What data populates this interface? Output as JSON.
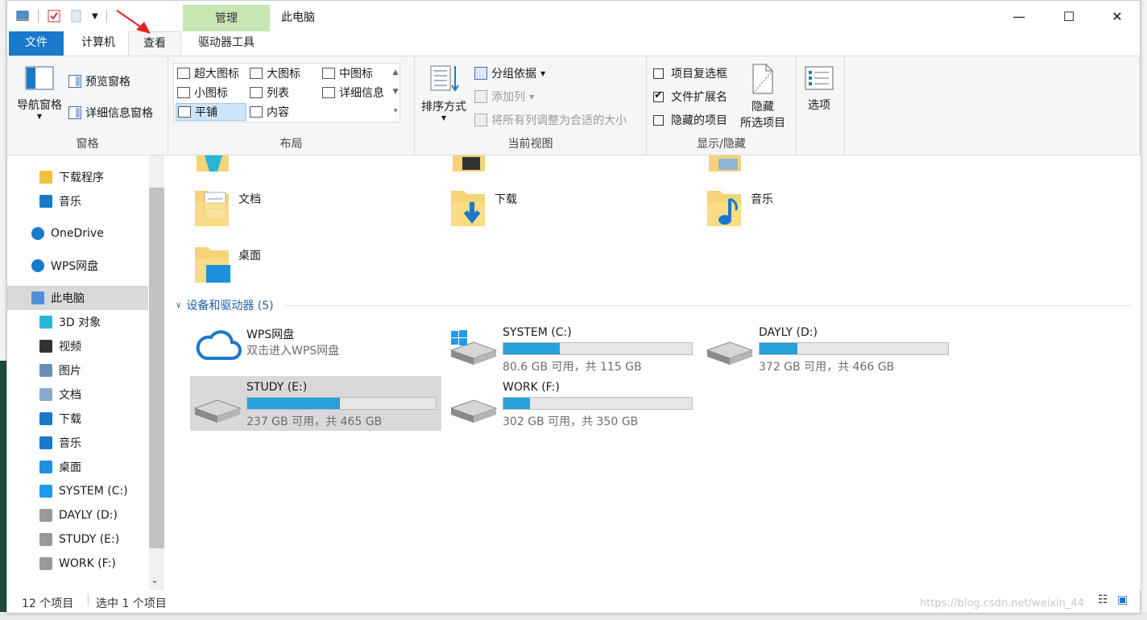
{
  "window": {
    "title": "此电脑",
    "context_tab": "管理"
  },
  "tabs": {
    "file": "文件",
    "computer": "计算机",
    "view": "查看",
    "drive_tools": "驱动器工具"
  },
  "ribbon": {
    "panes": {
      "nav_pane": "导航窗格",
      "preview_pane": "预览窗格",
      "details_pane": "详细信息窗格",
      "label": "窗格"
    },
    "layout": {
      "extra_large": "超大图标",
      "large": "大图标",
      "medium": "中图标",
      "small": "小图标",
      "list": "列表",
      "details": "详细信息",
      "tiles": "平铺",
      "content": "内容",
      "label": "布局"
    },
    "current_view": {
      "sort_by": "排序方式",
      "group_by": "分组依据",
      "add_column": "添加列",
      "fit_columns": "将所有列调整为合适的大小",
      "label": "当前视图"
    },
    "show_hide": {
      "item_checkboxes": "项目复选框",
      "file_extensions": "文件扩展名",
      "hidden_items": "隐藏的项目",
      "hide_selected_1": "隐藏",
      "hide_selected_2": "所选项目",
      "label": "显示/隐藏",
      "item_checkboxes_checked": false,
      "file_extensions_checked": true,
      "hidden_items_checked": false
    },
    "options": "选项"
  },
  "nav": {
    "items": [
      {
        "label": "下载程序",
        "icon": "folder-icon"
      },
      {
        "label": "音乐",
        "icon": "music-icon"
      },
      {
        "label": "OneDrive",
        "icon": "cloud-icon"
      },
      {
        "label": "WPS网盘",
        "icon": "wps-cloud-icon"
      },
      {
        "label": "此电脑",
        "icon": "computer-icon"
      },
      {
        "label": "3D 对象",
        "icon": "3d-objects-icon"
      },
      {
        "label": "视频",
        "icon": "video-icon"
      },
      {
        "label": "图片",
        "icon": "pictures-icon"
      },
      {
        "label": "文档",
        "icon": "documents-icon"
      },
      {
        "label": "下载",
        "icon": "download-icon"
      },
      {
        "label": "音乐",
        "icon": "music-icon"
      },
      {
        "label": "桌面",
        "icon": "desktop-icon"
      },
      {
        "label": "SYSTEM (C:)",
        "icon": "windows-drive-icon"
      },
      {
        "label": "DAYLY (D:)",
        "icon": "drive-icon"
      },
      {
        "label": "STUDY (E:)",
        "icon": "drive-icon"
      },
      {
        "label": "WORK (F:)",
        "icon": "drive-icon"
      }
    ]
  },
  "folders": [
    {
      "label": "文档"
    },
    {
      "label": "下载"
    },
    {
      "label": "音乐"
    },
    {
      "label": "桌面"
    }
  ],
  "devices": {
    "header": "设备和驱动器 (5)",
    "wps": {
      "name": "WPS网盘",
      "sub": "双击进入WPS网盘"
    },
    "drives": [
      {
        "name": "SYSTEM (C:)",
        "free": "80.6 GB 可用，共 115 GB",
        "used_fraction": 0.3
      },
      {
        "name": "DAYLY (D:)",
        "free": "372 GB 可用，共 466 GB",
        "used_fraction": 0.2
      },
      {
        "name": "STUDY (E:)",
        "free": "237 GB 可用，共 465 GB",
        "used_fraction": 0.49
      },
      {
        "name": "WORK (F:)",
        "free": "302 GB 可用，共 350 GB",
        "used_fraction": 0.14
      }
    ]
  },
  "status": {
    "count": "12 个项目",
    "selected": "选中 1 个项目"
  },
  "watermark": "https://blog.csdn.net/weixin_44"
}
